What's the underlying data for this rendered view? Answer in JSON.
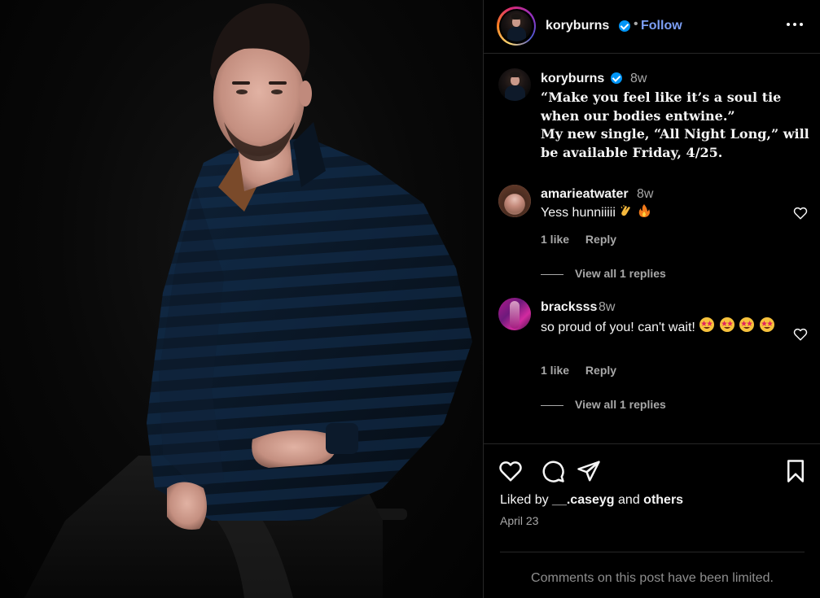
{
  "header": {
    "username": "koryburns",
    "dot": "•",
    "follow_label": "Follow"
  },
  "caption": {
    "username": "koryburns",
    "time": "8w",
    "lines": [
      "“Make you feel like it’s a soul tie",
      "when our bodies entwine.”",
      "My new single, “All Night Long,” will",
      "be available Friday, 4/25."
    ]
  },
  "comments": [
    {
      "username": "amarieatwater",
      "time": "8w",
      "text": "Yess hunniiiii",
      "emojis": [
        "clapping-hands",
        "fire"
      ],
      "likes": "1 like",
      "reply_label": "Reply",
      "view_replies": "View all 1 replies"
    },
    {
      "username": "bracksss",
      "time": "8w",
      "text": "so proud of you! can't wait!",
      "emojis": [
        "star-struck",
        "star-struck",
        "star-struck",
        "star-struck"
      ],
      "likes": "1 like",
      "reply_label": "Reply",
      "view_replies": "View all 1 replies"
    }
  ],
  "actions": {
    "icons": [
      "heart-icon",
      "comment-icon",
      "share-icon",
      "bookmark-icon"
    ],
    "liked_by_prefix": "Liked by",
    "liked_by_user": "__.caseyg",
    "liked_by_and": "and",
    "liked_by_others": "others",
    "date": "April 23"
  },
  "footer": {
    "limited_text": "Comments on this post have been limited."
  },
  "colors": {
    "accent": "#0095f6",
    "follow": "#7c9ff5",
    "muted": "#a8a8a8",
    "divider": "#262626"
  }
}
